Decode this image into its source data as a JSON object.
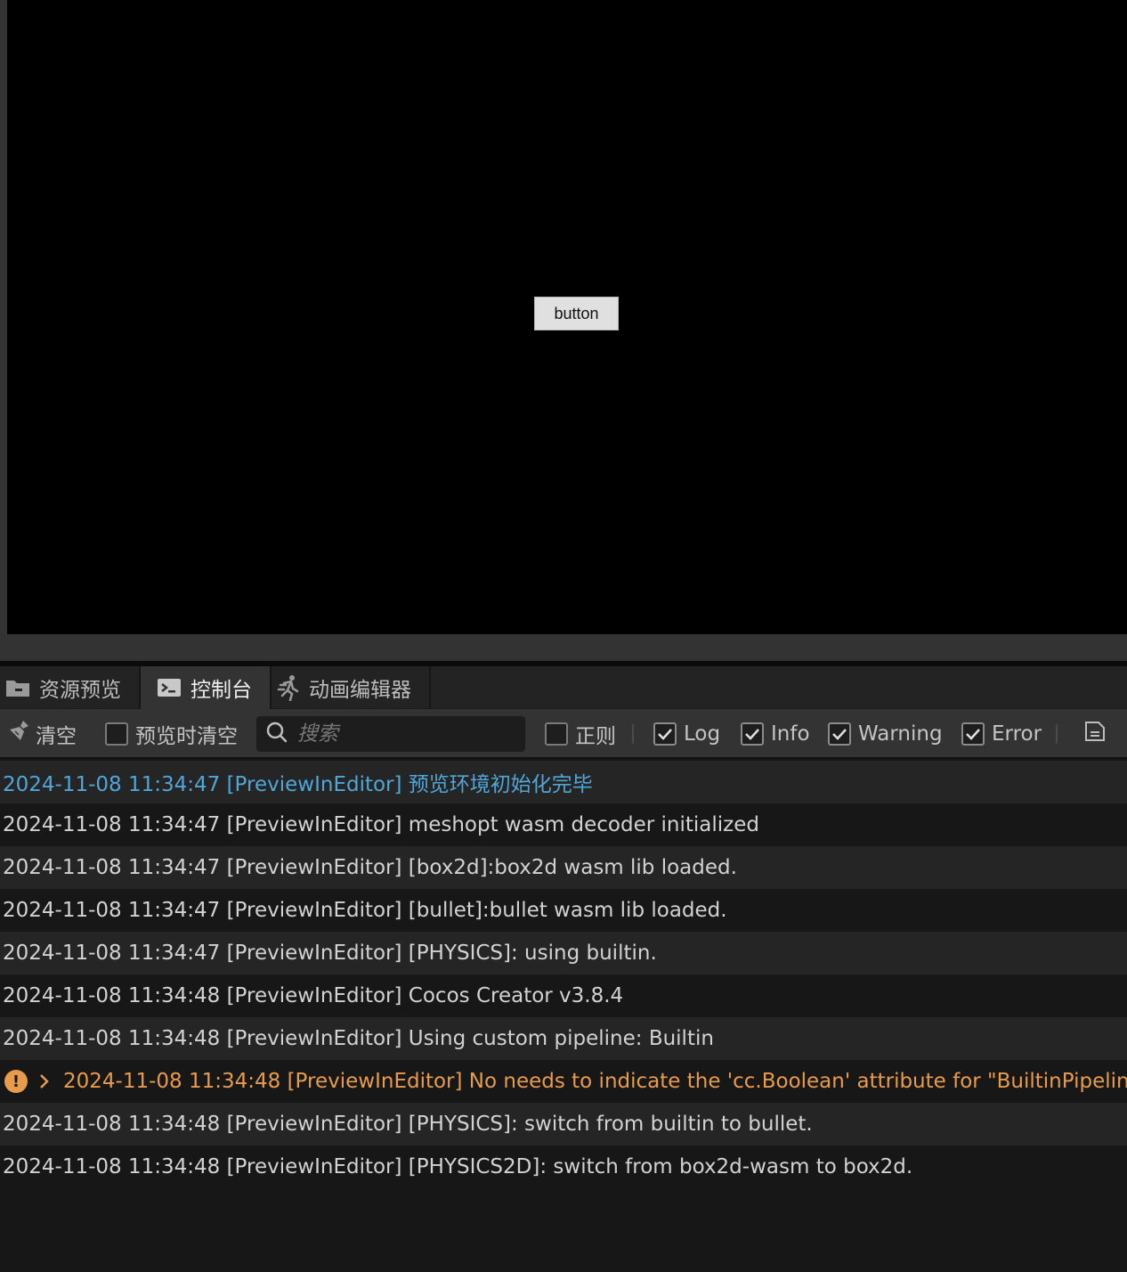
{
  "scene": {
    "button_label": "button"
  },
  "tabs": [
    {
      "label": "资源预览",
      "icon": "folder-icon",
      "active": false
    },
    {
      "label": "控制台",
      "icon": "terminal-icon",
      "active": true
    },
    {
      "label": "动画编辑器",
      "icon": "running-figure-icon",
      "active": false
    }
  ],
  "toolbar": {
    "clear_label": "清空",
    "clear_on_preview_label": "预览时清空",
    "clear_on_preview_checked": false,
    "search_placeholder": "搜索",
    "regex_label": "正则",
    "regex_checked": false,
    "log_label": "Log",
    "log_checked": true,
    "info_label": "Info",
    "info_checked": true,
    "warning_label": "Warning",
    "warning_checked": true,
    "error_label": "Error",
    "error_checked": true
  },
  "logs": [
    {
      "level": "info",
      "text": "2024-11-08 11:34:47 [PreviewInEditor] 预览环境初始化完毕"
    },
    {
      "level": "log",
      "text": "2024-11-08 11:34:47 [PreviewInEditor] meshopt wasm decoder initialized"
    },
    {
      "level": "log",
      "text": "2024-11-08 11:34:47 [PreviewInEditor] [box2d]:box2d wasm lib loaded."
    },
    {
      "level": "log",
      "text": "2024-11-08 11:34:47 [PreviewInEditor] [bullet]:bullet wasm lib loaded."
    },
    {
      "level": "log",
      "text": "2024-11-08 11:34:47 [PreviewInEditor] [PHYSICS]: using builtin."
    },
    {
      "level": "log",
      "text": "2024-11-08 11:34:48 [PreviewInEditor] Cocos Creator v3.8.4"
    },
    {
      "level": "log",
      "text": "2024-11-08 11:34:48 [PreviewInEditor] Using custom pipeline: Builtin"
    },
    {
      "level": "warning",
      "text": "2024-11-08 11:34:48 [PreviewInEditor] No needs to indicate the 'cc.Boolean' attribute for \"BuiltinPipelineSettings"
    },
    {
      "level": "log",
      "text": "2024-11-08 11:34:48 [PreviewInEditor] [PHYSICS]: switch from builtin to bullet."
    },
    {
      "level": "log",
      "text": "2024-11-08 11:34:48 [PreviewInEditor] [PHYSICS2D]: switch from box2d-wasm to box2d."
    }
  ],
  "colors": {
    "info": "#4fa6d9",
    "warning": "#e89b4a",
    "log": "#d2d2d2"
  }
}
